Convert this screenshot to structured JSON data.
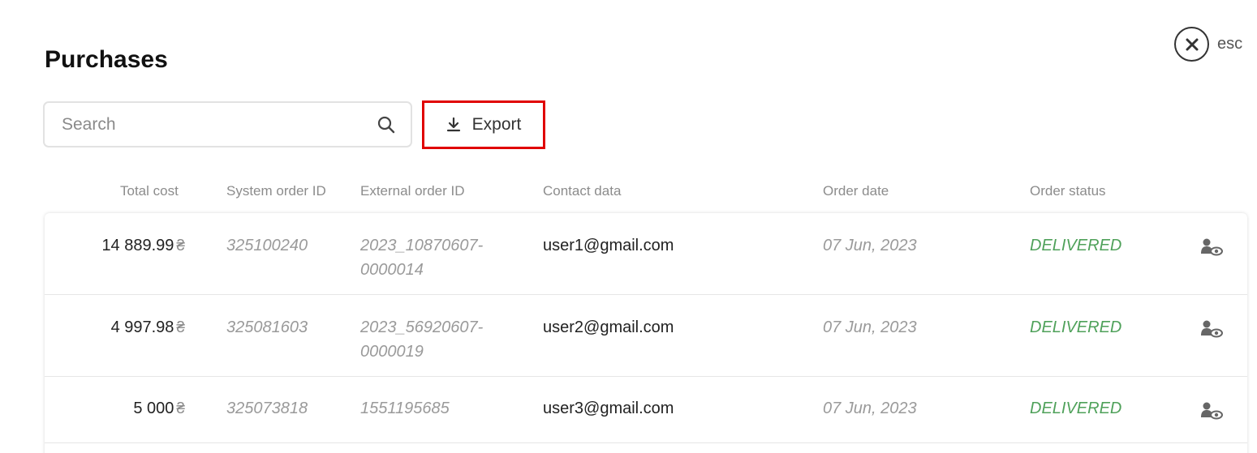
{
  "header": {
    "title": "Purchases",
    "close_label": "esc"
  },
  "toolbar": {
    "search_placeholder": "Search",
    "export_label": "Export"
  },
  "colors": {
    "status_delivered": "#4fa15a",
    "export_highlight": "#e00000"
  },
  "table": {
    "columns": [
      "Total cost",
      "System order ID",
      "External order ID",
      "Contact data",
      "Order date",
      "Order status"
    ],
    "rows": [
      {
        "total_cost": "14 889.99",
        "currency": "₴",
        "system_order_id": "325100240",
        "external_order_id": "2023_10870607-0000014",
        "contact": "user1@gmail.com",
        "order_date": "07 Jun, 2023",
        "status": "DELIVERED"
      },
      {
        "total_cost": "4 997.98",
        "currency": "₴",
        "system_order_id": "325081603",
        "external_order_id": "2023_56920607-0000019",
        "contact": "user2@gmail.com",
        "order_date": "07 Jun, 2023",
        "status": "DELIVERED"
      },
      {
        "total_cost": "5 000",
        "currency": "₴",
        "system_order_id": "325073818",
        "external_order_id": "1551195685",
        "contact": "user3@gmail.com",
        "order_date": "07 Jun, 2023",
        "status": "DELIVERED"
      }
    ]
  }
}
